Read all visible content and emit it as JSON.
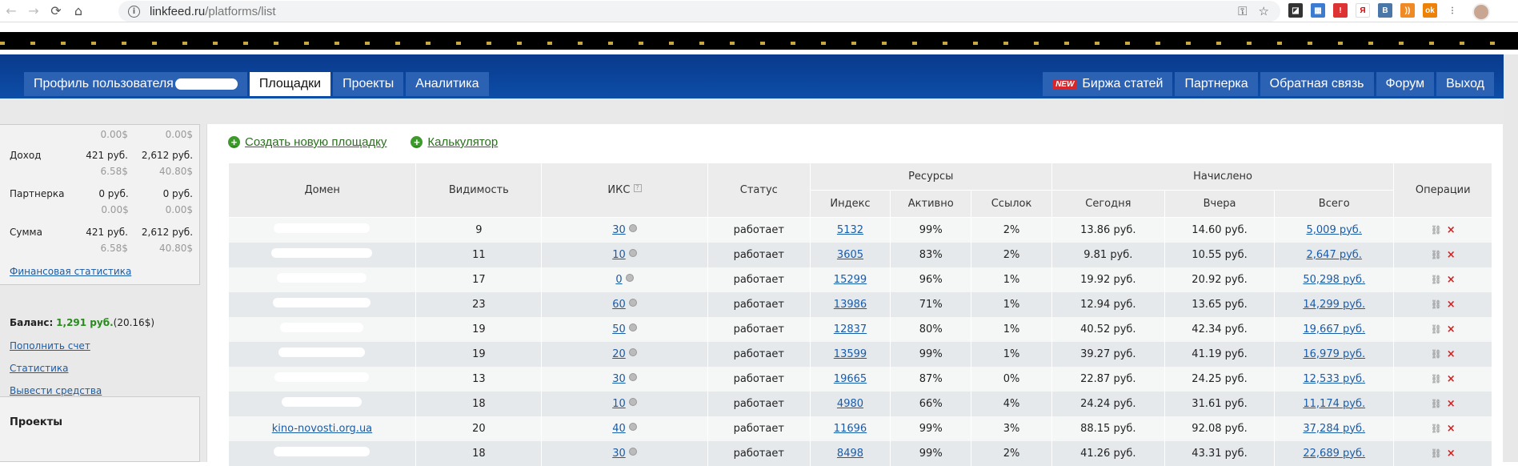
{
  "browser": {
    "url_host": "linkfeed.ru",
    "url_path": "/platforms/list"
  },
  "header": {
    "tabs_left": [
      {
        "label": "Профиль пользователя",
        "active": false,
        "blurred_suffix": true
      },
      {
        "label": "Площадки",
        "active": true
      },
      {
        "label": "Проекты",
        "active": false
      },
      {
        "label": "Аналитика",
        "active": false
      }
    ],
    "new_badge": "NEW",
    "tabs_right": [
      "Биржа статей",
      "Партнерка",
      "Обратная связь",
      "Форум",
      "Выход"
    ]
  },
  "sidebar": {
    "rows": [
      {
        "label": "",
        "v1": "",
        "v2": "",
        "s1": "0.00$",
        "s2": "0.00$"
      },
      {
        "label": "Доход",
        "v1": "421 руб.",
        "v2": "2,612 руб.",
        "s1": "6.58$",
        "s2": "40.80$"
      },
      {
        "label": "Партнерка",
        "v1": "0 руб.",
        "v2": "0 руб.",
        "s1": "0.00$",
        "s2": "0.00$"
      },
      {
        "label": "Сумма",
        "v1": "421 руб.",
        "v2": "2,612 руб.",
        "s1": "6.58$",
        "s2": "40.80$"
      }
    ],
    "fin_link": "Финансовая статистика",
    "balance_label": "Баланс:",
    "balance_amount": "1,291 руб.",
    "balance_usd": "(20.16$)",
    "links": [
      "Пополнить счет",
      "Статистика",
      "Вывести средства"
    ],
    "projects_title": "Проекты"
  },
  "actions": {
    "create": "Создать новую площадку",
    "calc": "Калькулятор"
  },
  "table": {
    "headers": {
      "domain": "Домен",
      "visibility": "Видимость",
      "iks": "ИКС",
      "iks_help": "?",
      "status": "Статус",
      "resources": "Ресурсы",
      "index": "Индекс",
      "active": "Активно",
      "links": "Ссылок",
      "accrued": "Начислено",
      "today": "Сегодня",
      "yesterday": "Вчера",
      "total": "Всего",
      "ops": "Операции"
    },
    "rows": [
      {
        "domain": "",
        "blur": 120,
        "vis": "9",
        "iks": "30",
        "status": "работает",
        "index": "5132",
        "active": "99%",
        "links": "2%",
        "today": "13.86 руб.",
        "yest": "14.60 руб.",
        "total": "5,009 руб."
      },
      {
        "domain": "",
        "blur": 126,
        "vis": "11",
        "iks": "10",
        "status": "работает",
        "index": "3605",
        "active": "83%",
        "links": "2%",
        "today": "9.81 руб.",
        "yest": "10.55 руб.",
        "total": "2,647 руб."
      },
      {
        "domain": "",
        "blur": 112,
        "vis": "17",
        "iks": "0",
        "status": "работает",
        "index": "15299",
        "active": "96%",
        "links": "1%",
        "today": "19.92 руб.",
        "yest": "20.92 руб.",
        "total": "50,298 руб."
      },
      {
        "domain": "",
        "blur": 122,
        "vis": "23",
        "iks": "60",
        "status": "работает",
        "index": "13986",
        "active": "71%",
        "links": "1%",
        "today": "12.94 руб.",
        "yest": "13.65 руб.",
        "total": "14,299 руб."
      },
      {
        "domain": "",
        "blur": 104,
        "vis": "19",
        "iks": "50",
        "status": "работает",
        "index": "12837",
        "active": "80%",
        "links": "1%",
        "today": "40.52 руб.",
        "yest": "42.34 руб.",
        "total": "19,667 руб."
      },
      {
        "domain": "",
        "blur": 108,
        "vis": "19",
        "iks": "20",
        "status": "работает",
        "index": "13599",
        "active": "99%",
        "links": "1%",
        "today": "39.27 руб.",
        "yest": "41.19 руб.",
        "total": "16,979 руб."
      },
      {
        "domain": "",
        "blur": 118,
        "vis": "13",
        "iks": "30",
        "status": "работает",
        "index": "19665",
        "active": "87%",
        "links": "0%",
        "today": "22.87 руб.",
        "yest": "24.25 руб.",
        "total": "12,533 руб."
      },
      {
        "domain": "",
        "blur": 100,
        "vis": "18",
        "iks": "10",
        "status": "работает",
        "index": "4980",
        "active": "66%",
        "links": "4%",
        "today": "24.24 руб.",
        "yest": "31.61 руб.",
        "total": "11,174 руб."
      },
      {
        "domain": "kino-novosti.org.ua",
        "blur": 0,
        "vis": "20",
        "iks": "40",
        "status": "работает",
        "index": "11696",
        "active": "99%",
        "links": "3%",
        "today": "88.15 руб.",
        "yest": "92.08 руб.",
        "total": "37,284 руб."
      },
      {
        "domain": "",
        "blur": 120,
        "vis": "18",
        "iks": "30",
        "status": "работает",
        "index": "8498",
        "active": "99%",
        "links": "2%",
        "today": "41.26 руб.",
        "yest": "43.31 руб.",
        "total": "22,689 руб."
      }
    ]
  }
}
